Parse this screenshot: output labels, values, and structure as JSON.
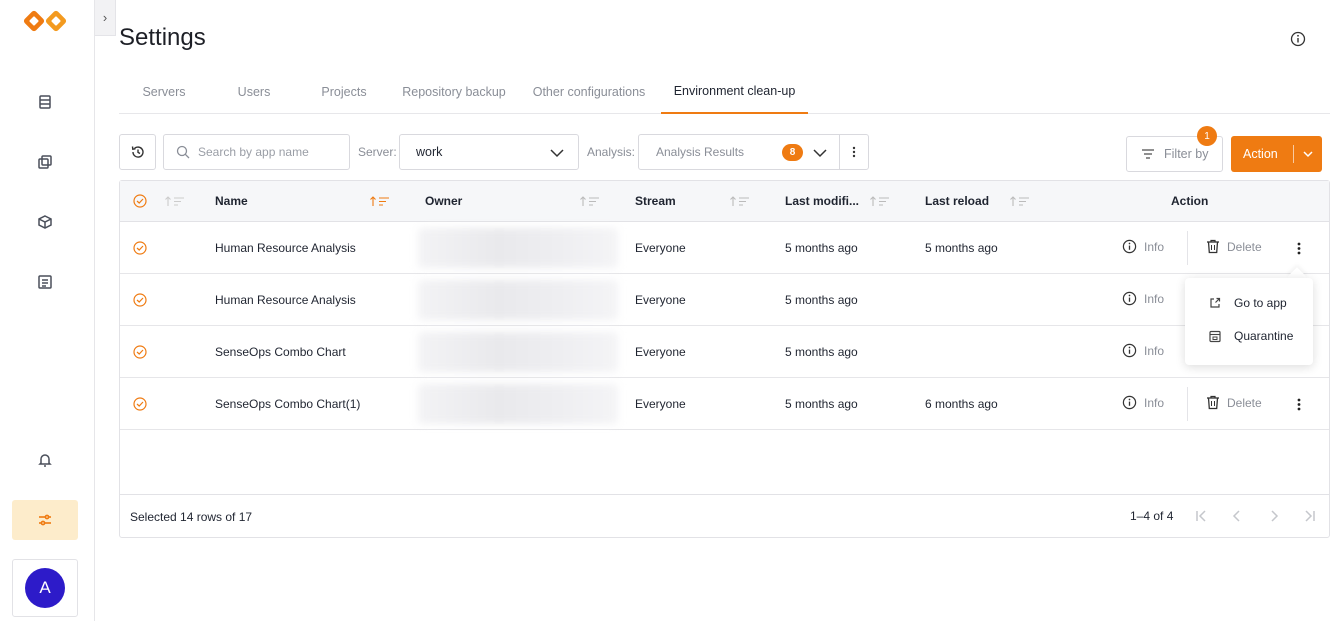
{
  "app": {
    "page_title": "Settings",
    "user_initial": "A"
  },
  "tabs": [
    {
      "label": "Servers"
    },
    {
      "label": "Users"
    },
    {
      "label": "Projects"
    },
    {
      "label": "Repository backup"
    },
    {
      "label": "Other configurations"
    },
    {
      "label": "Environment clean-up",
      "active": true
    }
  ],
  "toolbar": {
    "search_placeholder": "Search by app name",
    "server_label": "Server:",
    "server_value": "work",
    "analysis_label": "Analysis:",
    "analysis_value": "Analysis Results",
    "analysis_count": "8",
    "filter_label": "Filter by",
    "filter_count": "1",
    "action_label": "Action"
  },
  "table": {
    "columns": {
      "name": "Name",
      "owner": "Owner",
      "stream": "Stream",
      "last_modified": "Last modifi...",
      "last_reload": "Last reload",
      "action": "Action"
    },
    "rows": [
      {
        "name": "Human Resource Analysis",
        "stream": "Everyone",
        "last_modified": "5 months ago",
        "last_reload": "5 months ago"
      },
      {
        "name": "Human Resource Analysis",
        "stream": "Everyone",
        "last_modified": "5 months ago",
        "last_reload": ""
      },
      {
        "name": "SenseOps Combo Chart",
        "stream": "Everyone",
        "last_modified": "5 months ago",
        "last_reload": ""
      },
      {
        "name": "SenseOps Combo Chart(1)",
        "stream": "Everyone",
        "last_modified": "5 months ago",
        "last_reload": "6 months ago"
      }
    ],
    "info_label": "Info",
    "delete_label": "Delete",
    "footer_selected": "Selected 14 rows of 17",
    "footer_range": "1–4 of 4"
  },
  "menu": {
    "go_to_app": "Go to app",
    "quarantine": "Quarantine"
  },
  "colors": {
    "accent": "#ef7b12",
    "avatar": "#2d1bc9"
  }
}
